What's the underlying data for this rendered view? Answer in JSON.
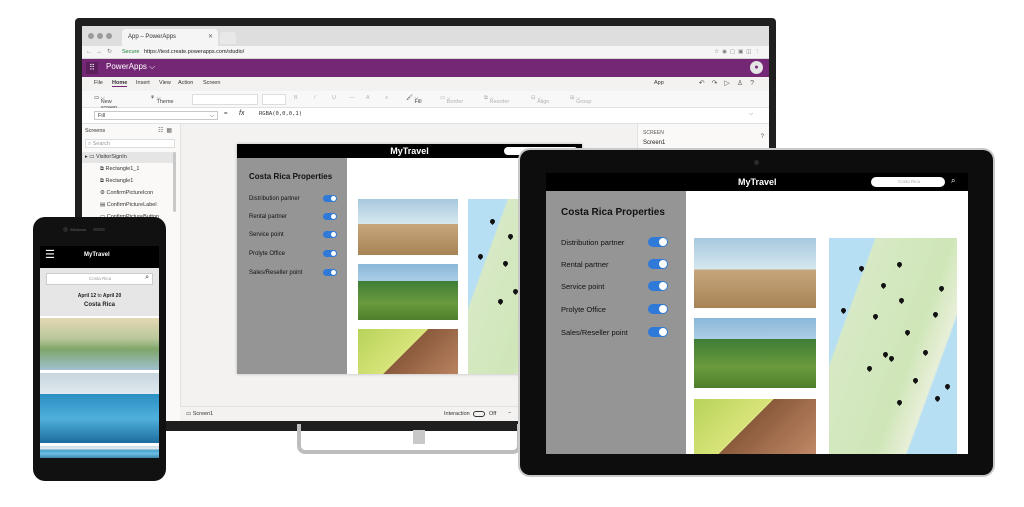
{
  "browser": {
    "tab_title": "App – PowerApps",
    "secure_label": "Secure",
    "url": "https://test.create.powerapps.com/studio/"
  },
  "studio": {
    "brand": "PowerApps",
    "menu": [
      "File",
      "Home",
      "Insert",
      "View",
      "Action",
      "Screen"
    ],
    "menu_right_label": "App",
    "ribbon": {
      "new_screen": "New screen",
      "theme": "Theme",
      "fill": "Fill",
      "border": "Border",
      "reorder": "Reorder",
      "align": "Align",
      "group": "Group"
    },
    "property": "Fill",
    "formula": "RGBA(0,0,0,1)",
    "screens_title": "Screens",
    "search_placeholder": "Search",
    "tree": [
      "VisitorSignIn",
      "Rectangle1_1",
      "Rectangle1",
      "ConfirmPictureIcon",
      "ConfirmPictureLabel",
      "ConfirmPictureButton"
    ],
    "right_panel": {
      "label": "SCREEN",
      "value": "Screen1"
    },
    "status_screen": "Screen1",
    "interaction_label": "Interaction",
    "interaction_state": "Off"
  },
  "app": {
    "brand": "MyTravel",
    "heading": "Costa Rica Properties",
    "search_placeholder": "Costa Rica",
    "toggles": [
      "Distribution partner",
      "Rental partner",
      "Service point",
      "Prolyte Office",
      "Sales/Reseller point"
    ]
  },
  "phone": {
    "device_brand": "Windows",
    "brand": "MyTravel",
    "search_placeholder": "Costa Rica",
    "date_from": "April 12",
    "date_to_word": "to",
    "date_to": "April 20",
    "destination": "Costa Rica"
  },
  "colors": {
    "powerapps_purple": "#742774",
    "toggle_blue": "#2f79d9",
    "panel_gray": "#959595"
  }
}
